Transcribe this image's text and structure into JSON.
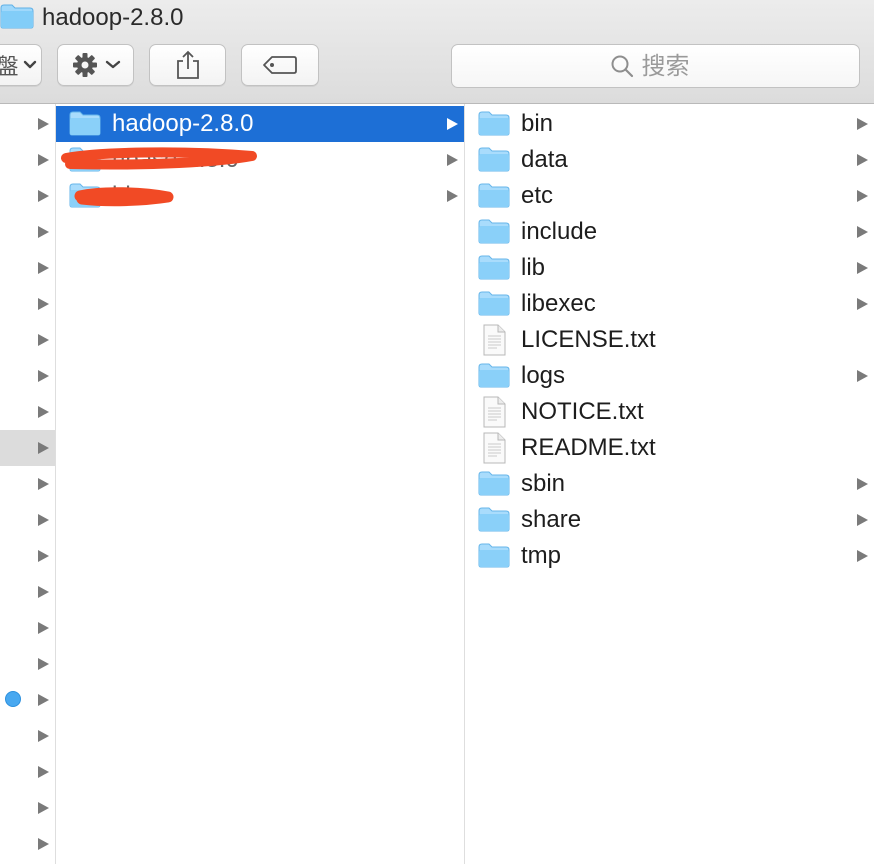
{
  "window": {
    "title": "hadoop-2.8.0"
  },
  "toolbar": {
    "view_glyph": "盤",
    "buttons": [
      {
        "name": "view-options",
        "icon": "chevron-down-icon"
      },
      {
        "name": "action-menu",
        "icon": "gear-icon"
      },
      {
        "name": "share",
        "icon": "share-icon"
      },
      {
        "name": "tags",
        "icon": "tag-icon"
      }
    ],
    "search_placeholder": "搜索"
  },
  "column1": {
    "items": [
      {
        "name": "hadoop-2.8.0",
        "kind": "folder",
        "selected": true
      },
      {
        "name": "hbase-1.3.0",
        "kind": "folder",
        "redacted": true
      },
      {
        "name": "hive",
        "kind": "folder",
        "redacted": true
      }
    ]
  },
  "column2": {
    "items": [
      {
        "name": "bin",
        "kind": "folder"
      },
      {
        "name": "data",
        "kind": "folder"
      },
      {
        "name": "etc",
        "kind": "folder"
      },
      {
        "name": "include",
        "kind": "folder"
      },
      {
        "name": "lib",
        "kind": "folder"
      },
      {
        "name": "libexec",
        "kind": "folder"
      },
      {
        "name": "LICENSE.txt",
        "kind": "file"
      },
      {
        "name": "logs",
        "kind": "folder"
      },
      {
        "name": "NOTICE.txt",
        "kind": "file"
      },
      {
        "name": "README.txt",
        "kind": "file"
      },
      {
        "name": "sbin",
        "kind": "folder"
      },
      {
        "name": "share",
        "kind": "folder"
      },
      {
        "name": "tmp",
        "kind": "folder"
      }
    ]
  },
  "colors": {
    "selection": "#1d6fd6",
    "folder": "#7ccaf7",
    "tag_blue": "#48a8f0",
    "redaction": "#f14a25"
  }
}
